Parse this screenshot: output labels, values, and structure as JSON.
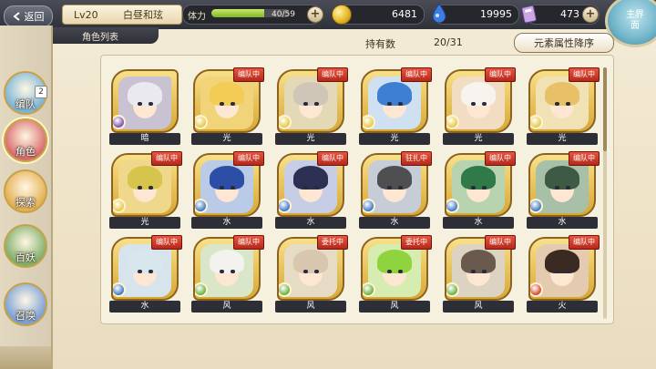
{
  "header": {
    "back_label": "返回",
    "level": "Lv20",
    "player_name": "白昼和玹",
    "stamina_label": "体力",
    "stamina_value": "40/59",
    "stamina_fraction": 0.68,
    "gold": "6481",
    "gems": "19995",
    "tickets": "473",
    "home_label": "主界面"
  },
  "subheader": {
    "tab_label": "角色列表",
    "owned_label": "持有数",
    "owned_value": "20/31",
    "sort_label": "元素属性降序"
  },
  "nav": {
    "items": [
      {
        "label": "编队",
        "color": "#7ab4d8",
        "badge": "2"
      },
      {
        "label": "角色",
        "color": "#d86a6a"
      },
      {
        "label": "探索",
        "color": "#e4b053"
      },
      {
        "label": "百妖",
        "color": "#7fae6a"
      },
      {
        "label": "召唤",
        "color": "#7aa0d6"
      }
    ]
  },
  "colors": {
    "dark": "#cfc0a0",
    "light": "#e7c948",
    "water": "#3f78c8",
    "wind": "#6bb13d",
    "fire": "#d8482c"
  },
  "characters": [
    {
      "element": "暗",
      "badge": "",
      "hair": "#e9e9ef",
      "bg": "#c8c2d2",
      "elem_color": "#7c4fb1"
    },
    {
      "element": "光",
      "badge": "编队中",
      "hair": "#f2cc55",
      "bg": "#f1d37a",
      "elem_color": "#e7c948"
    },
    {
      "element": "光",
      "badge": "编队中",
      "hair": "#cfc6b8",
      "bg": "#e4d9b6",
      "elem_color": "#e7c948"
    },
    {
      "element": "光",
      "badge": "编队中",
      "hair": "#3e7fd2",
      "bg": "#cfe0f0",
      "elem_color": "#e7c948"
    },
    {
      "element": "光",
      "badge": "编队中",
      "hair": "#f7f3ef",
      "bg": "#f2dcc2",
      "elem_color": "#e7c948"
    },
    {
      "element": "光",
      "badge": "编队中",
      "hair": "#e7c068",
      "bg": "#f1e2b6",
      "elem_color": "#e7c948"
    },
    {
      "element": "光",
      "badge": "编队中",
      "hair": "#d7c44d",
      "bg": "#efd88c",
      "elem_color": "#e7c948"
    },
    {
      "element": "水",
      "badge": "编队中",
      "hair": "#2c4ea6",
      "bg": "#b9cbe6",
      "elem_color": "#3f78c8"
    },
    {
      "element": "水",
      "badge": "编队中",
      "hair": "#2d2f53",
      "bg": "#c8cde6",
      "elem_color": "#3f78c8"
    },
    {
      "element": "水",
      "badge": "驻扎中",
      "hair": "#4f4f52",
      "bg": "#c7cdd6",
      "elem_color": "#3f78c8"
    },
    {
      "element": "水",
      "badge": "编队中",
      "hair": "#2f7a46",
      "bg": "#b8d3b0",
      "elem_color": "#3f78c8"
    },
    {
      "element": "水",
      "badge": "编队中",
      "hair": "#3c5a44",
      "bg": "#a8bfa8",
      "elem_color": "#3f78c8"
    },
    {
      "element": "水",
      "badge": "编队中",
      "hair": "#d8e6ee",
      "bg": "#d8e4ec",
      "elem_color": "#3f78c8"
    },
    {
      "element": "风",
      "badge": "编队中",
      "hair": "#f2f2ee",
      "bg": "#d9e7c8",
      "elem_color": "#6bb13d"
    },
    {
      "element": "风",
      "badge": "委托中",
      "hair": "#d8c7ae",
      "bg": "#e6dbc4",
      "elem_color": "#6bb13d"
    },
    {
      "element": "风",
      "badge": "委托中",
      "hair": "#8fd43e",
      "bg": "#d6ecb0",
      "elem_color": "#6bb13d"
    },
    {
      "element": "风",
      "badge": "编队中",
      "hair": "#6a5a4e",
      "bg": "#ddd3c2",
      "elem_color": "#6bb13d"
    },
    {
      "element": "火",
      "badge": "编队中",
      "hair": "#3a2a22",
      "bg": "#e4cbb0",
      "elem_color": "#d8482c"
    }
  ]
}
